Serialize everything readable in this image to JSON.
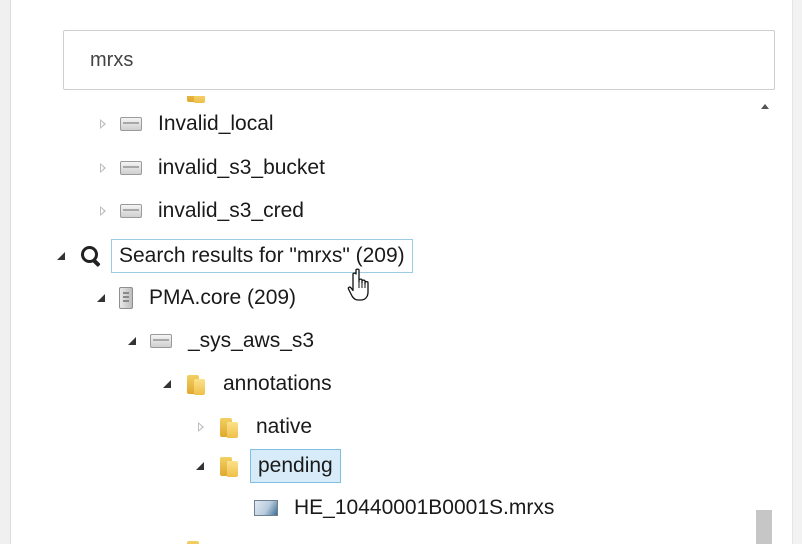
{
  "search": {
    "value": "mrxs"
  },
  "tree": {
    "nodes": [
      {
        "label": "Invalid_local",
        "icon": "drive-icon",
        "state": "collapsed"
      },
      {
        "label": "invalid_s3_bucket",
        "icon": "drive-icon",
        "state": "collapsed"
      },
      {
        "label": "invalid_s3_cred",
        "icon": "drive-icon",
        "state": "collapsed"
      },
      {
        "label": "Search results for \"mrxs\" (209)",
        "icon": "search-icon",
        "state": "expanded"
      },
      {
        "label": "PMA.core (209)",
        "icon": "server-icon",
        "state": "expanded"
      },
      {
        "label": "_sys_aws_s3",
        "icon": "drive-icon",
        "state": "expanded"
      },
      {
        "label": "annotations",
        "icon": "folder-icon",
        "state": "expanded"
      },
      {
        "label": "native",
        "icon": "folder-icon",
        "state": "collapsed"
      },
      {
        "label": "pending",
        "icon": "folder-icon",
        "state": "expanded"
      },
      {
        "label": "HE_10440001B0001S.mrxs",
        "icon": "slide-icon",
        "state": "leaf"
      }
    ]
  },
  "cursor": {
    "icon": "hand-pointer-icon"
  }
}
